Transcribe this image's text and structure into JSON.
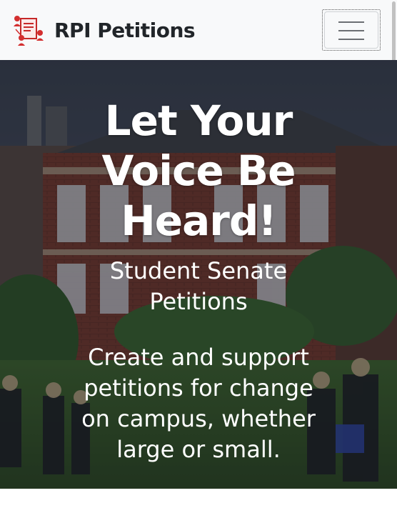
{
  "navbar": {
    "brand_text": "RPI Petitions",
    "logo_icon": "petition-people-icon",
    "toggler_icon": "hamburger-menu-icon",
    "brand_color": "#d32f2f"
  },
  "hero": {
    "title": "Let Your Voice Be Heard!",
    "subtitle": "Student Senate Petitions",
    "description": "Create and support petitions for change on campus, whether large or small."
  }
}
